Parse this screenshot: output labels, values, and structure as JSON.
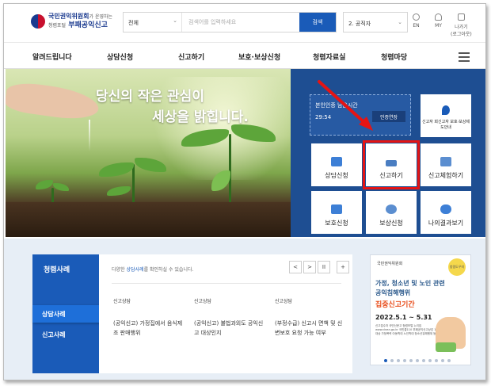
{
  "header": {
    "logo_line1": "국민권익위원회",
    "logo_line1_small": "가 운영하는",
    "logo_line2_small": "청렴포털",
    "logo_line2": "부패공익신고",
    "search_scope": "전체",
    "search_placeholder": "검색어를 입력하세요",
    "search_button": "검색",
    "target_select": "2. 공직자",
    "util": [
      {
        "label": "EN",
        "icon": "globe-icon"
      },
      {
        "label": "MY",
        "icon": "person-icon"
      },
      {
        "label": "나가기",
        "sub": "(로그아웃)",
        "icon": "lock-icon"
      }
    ]
  },
  "nav": {
    "items": [
      "알려드립니다",
      "상담신청",
      "신고하기",
      "보호·보상신청",
      "청렴자료실",
      "청렴마당"
    ],
    "menu_icon": "hamburger-icon"
  },
  "hero": {
    "title_line1": "당신의 작은 관심이",
    "title_line2": "세상을 밝힙니다."
  },
  "quick": {
    "auth_label": "본인인증 남은시간",
    "auth_time": "29:54",
    "auth_button": "인증연장",
    "tiles": [
      {
        "label": "신고자 회신고자 보호·보상제도안내",
        "icon": "location-pin-icon"
      },
      {
        "label": "상담신청",
        "icon": "chat-icon"
      },
      {
        "label": "신고하기",
        "icon": "upload-icon"
      },
      {
        "label": "신고체험하기",
        "icon": "laptop-icon"
      },
      {
        "label": "보호신청",
        "icon": "shield-person-icon"
      },
      {
        "label": "보상신청",
        "icon": "coin-icon"
      },
      {
        "label": "나의결과보기",
        "icon": "eye-icon"
      }
    ]
  },
  "cases": {
    "title": "청렴사례",
    "tabs": [
      "상담사례",
      "신고사례"
    ],
    "desc_prefix": "다양한 ",
    "desc_link": "상담사례",
    "desc_suffix": "를 확인하실 수 있습니다.",
    "pager": [
      "<",
      ">",
      "II",
      "+"
    ],
    "cards": [
      {
        "tag": "신고상담",
        "text": "(공익신고) 가정집에서 음식제조 판매행위"
      },
      {
        "tag": "신고상담",
        "text": "(공익신고) 불법과외도 공익신고 대상인지"
      },
      {
        "tag": "신고상담",
        "text": "(부정수급) 신고시 면책 및 신변보호 요청 가능 여부"
      }
    ]
  },
  "banner": {
    "org": "국민권익위원회",
    "badge": "청렴도우미",
    "line1": "가정, 청소년 및 노인 관련",
    "line2": "공익침해행위",
    "line3": "집중신고기간",
    "date": "2022.5.1 ~ 5.31",
    "fine": "신고접수처 국민신문고 청렴포털 누리집 www.clean.go.kr 국민콜110 부패공익신고상담 1398 대상 가정폭력 아동학대 노인학대 청소년유해행위 등"
  },
  "colors": {
    "brand_blue": "#1a5bb8",
    "quick_panel": "#1e4e92",
    "highlight_red": "#e51414"
  }
}
